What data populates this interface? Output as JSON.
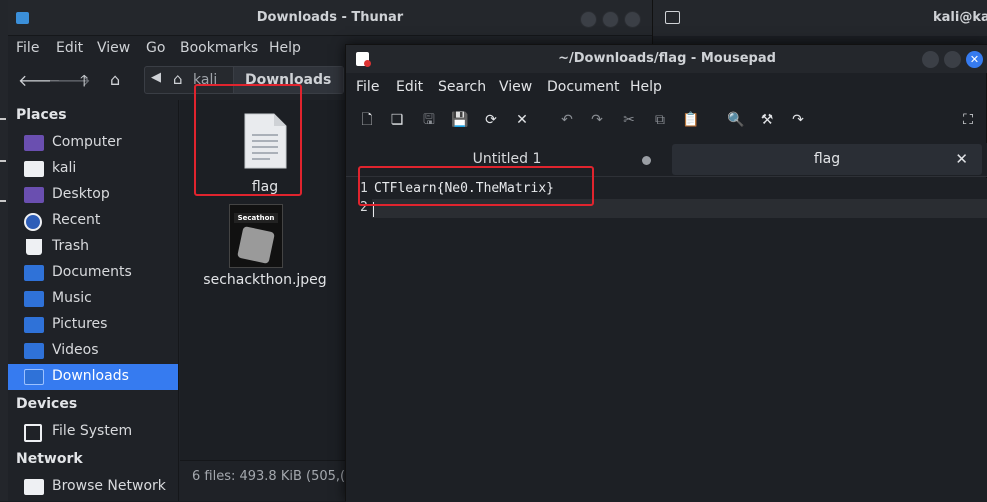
{
  "thunar": {
    "title": "Downloads - Thunar",
    "menu": [
      "File",
      "Edit",
      "View",
      "Go",
      "Bookmarks",
      "Help"
    ],
    "path": [
      "kali",
      "Downloads"
    ],
    "sidebar": {
      "places_header": "Places",
      "places": [
        {
          "label": "Computer",
          "icon": "computer-icon"
        },
        {
          "label": "kali",
          "icon": "home-folder-icon"
        },
        {
          "label": "Desktop",
          "icon": "desktop-folder-icon"
        },
        {
          "label": "Recent",
          "icon": "recent-icon"
        },
        {
          "label": "Trash",
          "icon": "trash-icon"
        },
        {
          "label": "Documents",
          "icon": "documents-folder-icon"
        },
        {
          "label": "Music",
          "icon": "music-folder-icon"
        },
        {
          "label": "Pictures",
          "icon": "pictures-folder-icon"
        },
        {
          "label": "Videos",
          "icon": "videos-folder-icon"
        },
        {
          "label": "Downloads",
          "icon": "downloads-folder-icon"
        }
      ],
      "devices_header": "Devices",
      "devices": [
        {
          "label": "File System",
          "icon": "drive-icon"
        }
      ],
      "network_header": "Network",
      "network": [
        {
          "label": "Browse Network",
          "icon": "network-icon"
        }
      ]
    },
    "files": [
      {
        "name": "flag",
        "icon": "text-file-icon"
      },
      {
        "name": "sechackthon.jpeg",
        "icon": "image-thumbnail-icon"
      }
    ],
    "thumbnail_text": "Secathon",
    "status": "6 files: 493.8 KiB (505,("
  },
  "terminal": {
    "title": "kali@kali:"
  },
  "mousepad": {
    "title": "~/Downloads/flag - Mousepad",
    "menu": [
      "File",
      "Edit",
      "Search",
      "View",
      "Document",
      "Help"
    ],
    "tabs": [
      {
        "label": "Untitled 1",
        "modified": true
      },
      {
        "label": "flag",
        "active": true
      }
    ],
    "lines": [
      {
        "num": "1",
        "text": "CTFlearn{Ne0.TheMatrix}"
      },
      {
        "num": "2",
        "text": ""
      }
    ]
  },
  "colors": {
    "accent": "#367bf0",
    "highlight": "#e0242e"
  }
}
